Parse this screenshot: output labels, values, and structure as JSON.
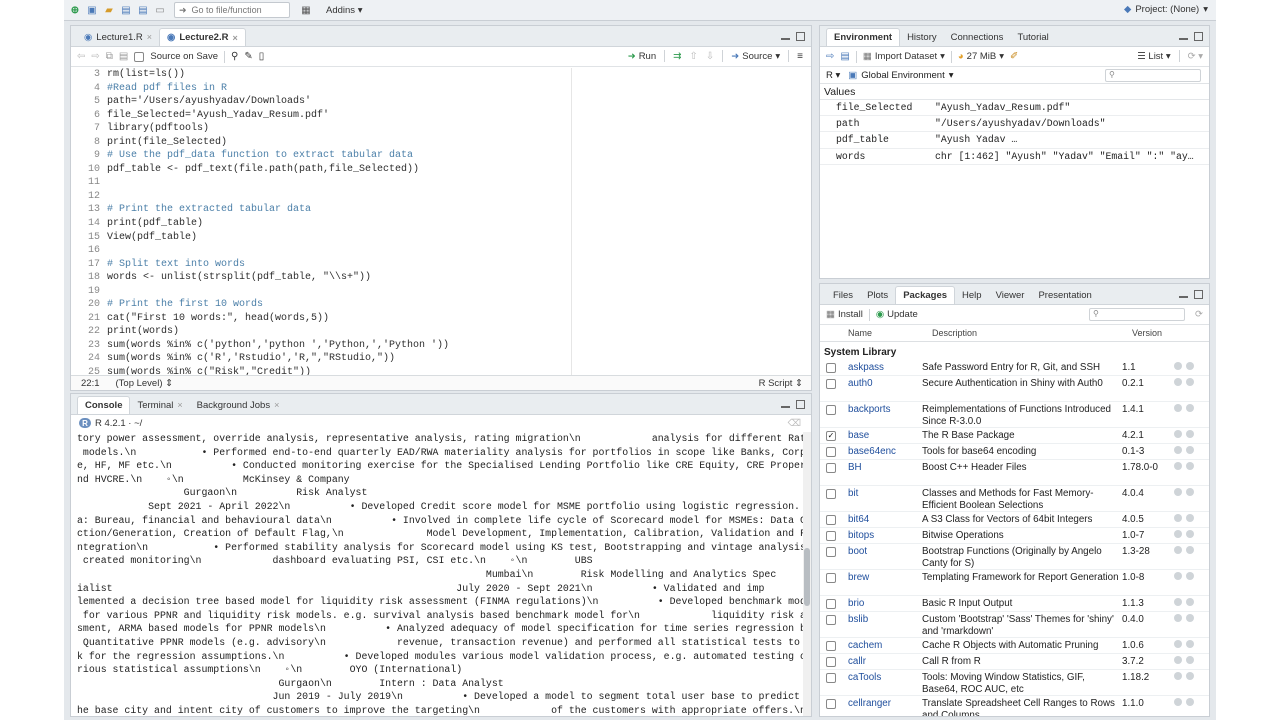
{
  "toolbar": {
    "go_to_file": "Go to file/function",
    "addins": "Addins",
    "project": "Project: (None)"
  },
  "source": {
    "tabs": [
      {
        "label": "Lecture1.R"
      },
      {
        "label": "Lecture2.R"
      }
    ],
    "source_on_save": "Source on Save",
    "run": "Run",
    "source_btn": "Source",
    "lines": [
      {
        "n": "3",
        "t": "rm(list=ls())",
        "c": false
      },
      {
        "n": "4",
        "t": "#Read pdf files in R",
        "c": true
      },
      {
        "n": "5",
        "t": "path='/Users/ayushyadav/Downloads'",
        "c": false
      },
      {
        "n": "6",
        "t": "file_Selected='Ayush_Yadav_Resum.pdf'",
        "c": false
      },
      {
        "n": "7",
        "t": "library(pdftools)",
        "c": false
      },
      {
        "n": "8",
        "t": "print(file_Selected)",
        "c": false
      },
      {
        "n": "9",
        "t": "# Use the pdf_data function to extract tabular data",
        "c": true
      },
      {
        "n": "10",
        "t": "pdf_table <- pdf_text(file.path(path,file_Selected))",
        "c": false
      },
      {
        "n": "11",
        "t": "",
        "c": false
      },
      {
        "n": "12",
        "t": "",
        "c": false
      },
      {
        "n": "13",
        "t": "# Print the extracted tabular data",
        "c": true
      },
      {
        "n": "14",
        "t": "print(pdf_table)",
        "c": false
      },
      {
        "n": "15",
        "t": "View(pdf_table)",
        "c": false
      },
      {
        "n": "16",
        "t": "",
        "c": false
      },
      {
        "n": "17",
        "t": "# Split text into words",
        "c": true
      },
      {
        "n": "18",
        "t": "words <- unlist(strsplit(pdf_table, \"\\\\s+\"))",
        "c": false
      },
      {
        "n": "19",
        "t": "",
        "c": false
      },
      {
        "n": "20",
        "t": "# Print the first 10 words",
        "c": true
      },
      {
        "n": "21",
        "t": "cat(\"First 10 words:\", head(words,5))",
        "c": false
      },
      {
        "n": "22",
        "t": "print(words)",
        "c": false
      },
      {
        "n": "23",
        "t": "sum(words %in% c('python','python ','Python,','Python '))",
        "c": false
      },
      {
        "n": "24",
        "t": "sum(words %in% c('R','Rstudio','R,\",\"RStudio,\"))",
        "c": false
      },
      {
        "n": "25",
        "t": "sum(words %in% c(\"Risk\",\"Credit\"))",
        "c": false
      }
    ],
    "status_pos": "22:1",
    "status_scope": "(Top Level)",
    "status_type": "R Script"
  },
  "console": {
    "tabs": [
      {
        "label": "Console"
      },
      {
        "label": "Terminal"
      },
      {
        "label": "Background Jobs"
      }
    ],
    "r_version": "R 4.2.1 · ~/",
    "lines": [
      "tory power assessment, override analysis, representative analysis, rating migration\\n            analysis for different Rating",
      " models.\\n           • Performed end-to-end quarterly EAD/RWA materiality analysis for portfolios in scope like Banks, Corporat",
      "e, HF, MF etc.\\n          • Conducted monitoring exercise for the Specialised Lending Portfolio like CRE Equity, CRE Property a",
      "nd HVCRE.\\n    ◦\\n          McKinsey & Company",
      "                  Gurgaon\\n          Risk Analyst",
      "            Sept 2021 - April 2022\\n          • Developed Credit score model for MSME portfolio using logistic regression. Dat",
      "a: Bureau, financial and behavioural data\\n          • Involved in complete life cycle of Scorecard model for MSMEs: Data Colle",
      "ction/Generation, Creation of Default Flag,\\n              Model Development, Implementation, Calibration, Validation and Final I",
      "ntegration\\n           • Performed stability analysis for Scorecard model using KS test, Bootstrapping and vintage analysis and",
      " created monitoring\\n            dashboard evaluating PSI, CSI etc.\\n    ◦\\n        UBS",
      "                                                                     Mumbai\\n        Risk Modelling and Analytics Spec",
      "ialist                                                          July 2020 - Sept 2021\\n          • Validated and imp",
      "lemented a decision tree based model for liquidity risk assessment (FINMA regulations)\\n          • Developed benchmark models",
      " for various PPNR and liquidity risk models. e.g. survival analysis based benchmark model for\\n            liquidity risk asses",
      "sment, ARMA based models for PPNR models\\n          • Analyzed adequacy of model specification for time series regression based",
      " Quantitative PPNR models (e.g. advisory\\n            revenue, transaction revenue) and performed all statistical tests to chec",
      "k for the regression assumptions.\\n          • Developed modules various model validation process, e.g. automated testing of va",
      "rious statistical assumptions\\n    ◦\\n        OYO (International)",
      "                                  Gurgaon\\n        Intern : Data Analyst",
      "                                 Jun 2019 - July 2019\\n          • Developed a model to segment total user base to predict t",
      "he base city and intent city of customers to improve the targeting\\n            of the customers with appropriate offers.\\n"
    ]
  },
  "environment": {
    "tabs": [
      {
        "label": "Environment"
      },
      {
        "label": "History"
      },
      {
        "label": "Connections"
      },
      {
        "label": "Tutorial"
      }
    ],
    "import_dataset": "Import Dataset",
    "memory": "27 MiB",
    "list_mode": "List",
    "lang": "R",
    "scope": "Global Environment",
    "values_header": "Values",
    "values": [
      {
        "name": "file_Selected",
        "value": "\"Ayush_Yadav_Resum.pdf\""
      },
      {
        "name": "path",
        "value": "\"/Users/ayushyadav/Downloads\""
      },
      {
        "name": "pdf_table",
        "value": "\"Ayush Yadav                                         …"
      },
      {
        "name": "words",
        "value": "chr [1:462] \"Ayush\" \"Yadav\" \"Email\" \":\" \"ay…"
      }
    ]
  },
  "packages_pane": {
    "tabs": [
      {
        "label": "Files"
      },
      {
        "label": "Plots"
      },
      {
        "label": "Packages"
      },
      {
        "label": "Help"
      },
      {
        "label": "Viewer"
      },
      {
        "label": "Presentation"
      }
    ],
    "install": "Install",
    "update": "Update",
    "col_name": "Name",
    "col_desc": "Description",
    "col_version": "Version",
    "system_library": "System Library",
    "packages": [
      {
        "name": "askpass",
        "desc": "Safe Password Entry for R, Git, and SSH",
        "ver": "1.1",
        "checked": false,
        "h": 16
      },
      {
        "name": "auth0",
        "desc": "Secure Authentication in Shiny with Auth0",
        "ver": "0.2.1",
        "checked": false,
        "h": 26
      },
      {
        "name": "backports",
        "desc": "Reimplementations of Functions Introduced Since R-3.0.0",
        "ver": "1.4.1",
        "checked": false,
        "h": 26
      },
      {
        "name": "base",
        "desc": "The R Base Package",
        "ver": "4.2.1",
        "checked": true,
        "h": 16
      },
      {
        "name": "base64enc",
        "desc": "Tools for base64 encoding",
        "ver": "0.1-3",
        "checked": false,
        "h": 16
      },
      {
        "name": "BH",
        "desc": "Boost C++ Header Files",
        "ver": "1.78.0-0",
        "checked": false,
        "h": 26
      },
      {
        "name": "bit",
        "desc": "Classes and Methods for Fast Memory-Efficient Boolean Selections",
        "ver": "4.0.4",
        "checked": false,
        "h": 26
      },
      {
        "name": "bit64",
        "desc": "A S3 Class for Vectors of 64bit Integers",
        "ver": "4.0.5",
        "checked": false,
        "h": 16
      },
      {
        "name": "bitops",
        "desc": "Bitwise Operations",
        "ver": "1.0-7",
        "checked": false,
        "h": 16
      },
      {
        "name": "boot",
        "desc": "Bootstrap Functions (Originally by Angelo Canty for S)",
        "ver": "1.3-28",
        "checked": false,
        "h": 26
      },
      {
        "name": "brew",
        "desc": "Templating Framework for Report Generation",
        "ver": "1.0-8",
        "checked": false,
        "h": 26
      },
      {
        "name": "brio",
        "desc": "Basic R Input Output",
        "ver": "1.1.3",
        "checked": false,
        "h": 16
      },
      {
        "name": "bslib",
        "desc": "Custom 'Bootstrap' 'Sass' Themes for 'shiny' and 'rmarkdown'",
        "ver": "0.4.0",
        "checked": false,
        "h": 26
      },
      {
        "name": "cachem",
        "desc": "Cache R Objects with Automatic Pruning",
        "ver": "1.0.6",
        "checked": false,
        "h": 16
      },
      {
        "name": "callr",
        "desc": "Call R from R",
        "ver": "3.7.2",
        "checked": false,
        "h": 16
      },
      {
        "name": "caTools",
        "desc": "Tools: Moving Window Statistics, GIF, Base64, ROC AUC, etc",
        "ver": "1.18.2",
        "checked": false,
        "h": 26
      },
      {
        "name": "cellranger",
        "desc": "Translate Spreadsheet Cell Ranges to Rows and Columns",
        "ver": "1.1.0",
        "checked": false,
        "h": 26
      }
    ]
  }
}
